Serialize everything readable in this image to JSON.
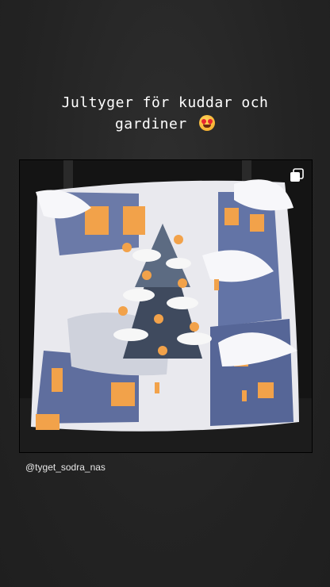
{
  "story": {
    "caption_line1": "Jultyger för kuddar och",
    "caption_line2": "gardiner",
    "caption_emoji": "heart-eyes-emoji"
  },
  "post": {
    "image_subject": "christmas-pillow-photo",
    "multi_image_icon": "carousel-icon",
    "username_tag": "@tyget_sodra_nas"
  }
}
